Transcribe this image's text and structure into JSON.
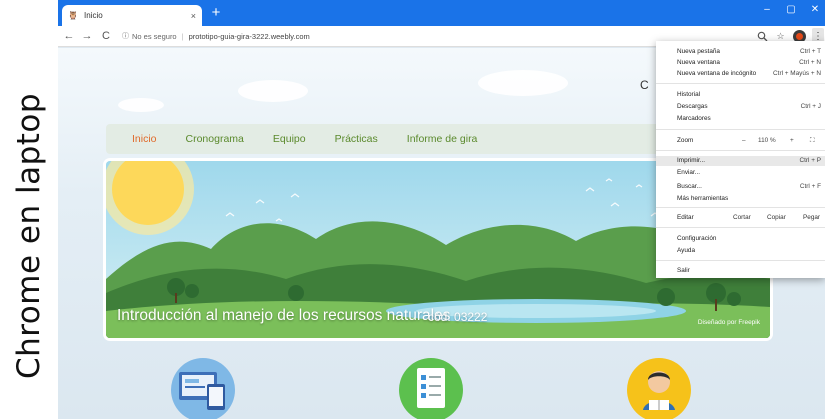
{
  "caption": "Chrome en laptop",
  "browser": {
    "tab_title": "Inicio",
    "tab_close": "×",
    "new_tab": "+",
    "window_controls": {
      "minimize": "–",
      "maximize": "▢",
      "close": "✕"
    },
    "nav": {
      "back": "←",
      "forward": "→",
      "reload": "C"
    },
    "address": {
      "security_label": "No es seguro",
      "separator": "|",
      "url": "prototipo-guia-gira-3222.weebly.com"
    },
    "icons": [
      "zoom-icon",
      "star-icon",
      "profile-icon",
      "menu-kebab-icon"
    ],
    "accent_color": "#1a73e8"
  },
  "site": {
    "nav_items": [
      "Inicio",
      "Cronograma",
      "Equipo",
      "Prácticas",
      "Informe de gira"
    ],
    "active_nav": "Inicio",
    "nav_colors": {
      "active": "#e06a2b",
      "default": "#5b8a2d"
    },
    "banner_title": "Introducción al manejo de los recursos naturales",
    "banner_code": "cód. 03222",
    "banner_credit": "Diseñado por Freepik",
    "header_fragment": "C",
    "features": [
      "devices-icon",
      "checklist-icon",
      "student-reading-icon"
    ]
  },
  "chrome_menu": {
    "new_tab": {
      "label": "Nueva pestaña",
      "shortcut": "Ctrl + T"
    },
    "new_window": {
      "label": "Nueva ventana",
      "shortcut": "Ctrl + N"
    },
    "incognito": {
      "label": "Nueva ventana de incógnito",
      "shortcut": "Ctrl + Mayús + N"
    },
    "history": {
      "label": "Historial"
    },
    "downloads": {
      "label": "Descargas",
      "shortcut": "Ctrl + J"
    },
    "bookmarks": {
      "label": "Marcadores"
    },
    "zoom": {
      "label": "Zoom",
      "minus": "–",
      "value": "110 %",
      "plus": "+",
      "fullscreen": "⛶"
    },
    "print": {
      "label": "Imprimir...",
      "shortcut": "Ctrl + P"
    },
    "send": {
      "label": "Enviar..."
    },
    "find": {
      "label": "Buscar...",
      "shortcut": "Ctrl + F"
    },
    "more_tools": {
      "label": "Más herramientas"
    },
    "edit": {
      "label": "Editar",
      "cut": "Cortar",
      "copy": "Copiar",
      "paste": "Pegar"
    },
    "settings": {
      "label": "Configuración"
    },
    "help": {
      "label": "Ayuda"
    },
    "exit": {
      "label": "Salir"
    },
    "highlighted_item": "Imprimir..."
  }
}
